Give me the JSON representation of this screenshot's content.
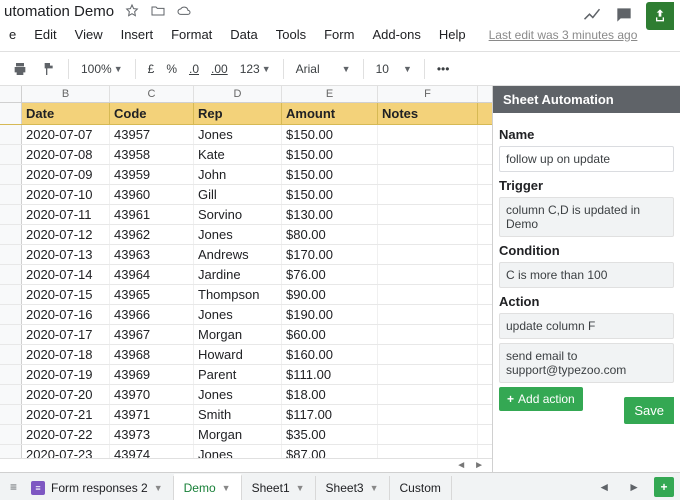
{
  "titlebar": {
    "title": "utomation Demo"
  },
  "topright": {
    "share": "Share"
  },
  "menubar": {
    "items": [
      "e",
      "Edit",
      "View",
      "Insert",
      "Format",
      "Data",
      "Tools",
      "Form",
      "Add-ons",
      "Help"
    ],
    "last_edit": "Last edit was 3 minutes ago"
  },
  "toolbar": {
    "zoom": "100%",
    "currency": "£",
    "percent": "%",
    "dec_dec": ".0",
    "dec_inc": ".00",
    "numfmt": "123",
    "font": "Arial",
    "size": "10",
    "more": "•••"
  },
  "columns": [
    "B",
    "C",
    "D",
    "E",
    "F"
  ],
  "headers": {
    "b": "Date",
    "c": "Code",
    "d": "Rep",
    "e": "Amount",
    "f": "Notes"
  },
  "rows": [
    {
      "b": "2020-07-07",
      "c": "43957",
      "d": "Jones",
      "e": "$150.00",
      "f": ""
    },
    {
      "b": "2020-07-08",
      "c": "43958",
      "d": "Kate",
      "e": "$150.00",
      "f": ""
    },
    {
      "b": "2020-07-09",
      "c": "43959",
      "d": "John",
      "e": "$150.00",
      "f": ""
    },
    {
      "b": "2020-07-10",
      "c": "43960",
      "d": "Gill",
      "e": "$150.00",
      "f": ""
    },
    {
      "b": "2020-07-11",
      "c": "43961",
      "d": "Sorvino",
      "e": "$130.00",
      "f": ""
    },
    {
      "b": "2020-07-12",
      "c": "43962",
      "d": "Jones",
      "e": "$80.00",
      "f": ""
    },
    {
      "b": "2020-07-13",
      "c": "43963",
      "d": "Andrews",
      "e": "$170.00",
      "f": ""
    },
    {
      "b": "2020-07-14",
      "c": "43964",
      "d": "Jardine",
      "e": "$76.00",
      "f": ""
    },
    {
      "b": "2020-07-15",
      "c": "43965",
      "d": "Thompson",
      "e": "$90.00",
      "f": ""
    },
    {
      "b": "2020-07-16",
      "c": "43966",
      "d": "Jones",
      "e": "$190.00",
      "f": ""
    },
    {
      "b": "2020-07-17",
      "c": "43967",
      "d": "Morgan",
      "e": "$60.00",
      "f": ""
    },
    {
      "b": "2020-07-18",
      "c": "43968",
      "d": "Howard",
      "e": "$160.00",
      "f": ""
    },
    {
      "b": "2020-07-19",
      "c": "43969",
      "d": "Parent",
      "e": "$111.00",
      "f": ""
    },
    {
      "b": "2020-07-20",
      "c": "43970",
      "d": "Jones",
      "e": "$18.00",
      "f": ""
    },
    {
      "b": "2020-07-21",
      "c": "43971",
      "d": "Smith",
      "e": "$117.00",
      "f": ""
    },
    {
      "b": "2020-07-22",
      "c": "43973",
      "d": "Morgan",
      "e": "$35.00",
      "f": ""
    },
    {
      "b": "2020-07-23",
      "c": "43974",
      "d": "Jones",
      "e": "$87.00",
      "f": ""
    }
  ],
  "sidepanel": {
    "title": "Sheet Automation",
    "name_label": "Name",
    "name_value": "follow up on update",
    "trigger_label": "Trigger",
    "trigger_value": "column C,D is updated in Demo",
    "condition_label": "Condition",
    "condition_value": "C is more than 100",
    "action_label": "Action",
    "action1": "update column F",
    "action2": "send email to support@typezoo.com",
    "add_action": "Add action",
    "save": "Save"
  },
  "tabs": {
    "form": "Form responses 2",
    "demo": "Demo",
    "s1": "Sheet1",
    "s3": "Sheet3",
    "custom": "Custom"
  }
}
